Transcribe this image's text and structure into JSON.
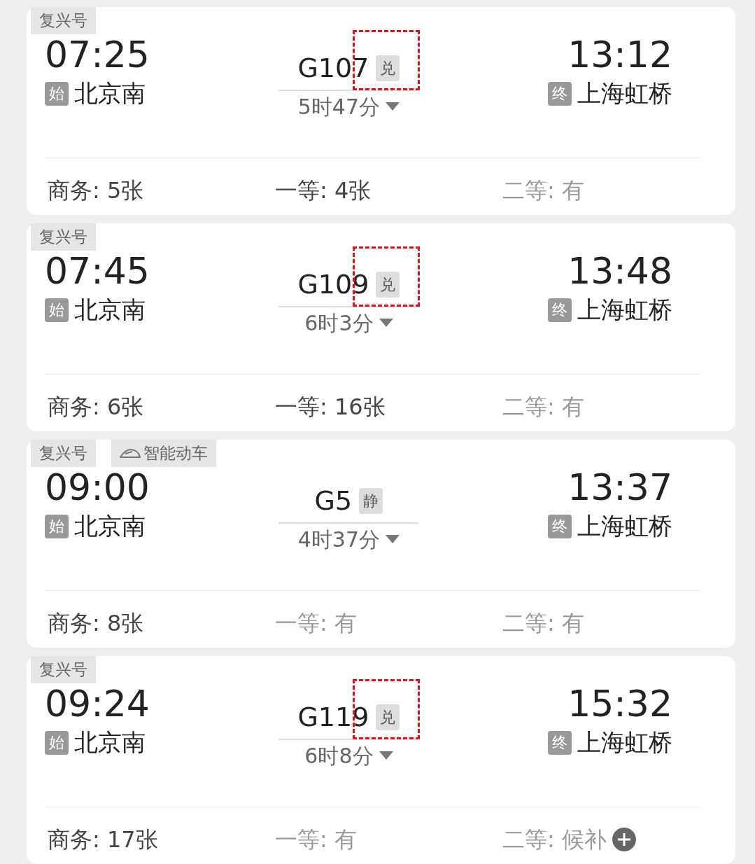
{
  "trains": [
    {
      "tags": [
        {
          "label": "复兴号",
          "kind": "plain"
        }
      ],
      "depart_time": "07:25",
      "depart_badge": "始",
      "depart_station": "北京南",
      "train_no": "G107",
      "train_badge": "兑",
      "highlighted": true,
      "duration": "5时47分",
      "arrive_time": "13:12",
      "arrive_badge": "终",
      "arrive_station": "上海虹桥",
      "seats": [
        {
          "label": "商务: ",
          "value": "5张",
          "available": true,
          "kind": "text"
        },
        {
          "label": "一等: ",
          "value": "4张",
          "available": true,
          "kind": "text"
        },
        {
          "label": "二等: ",
          "value": "有",
          "available": false,
          "kind": "text"
        }
      ]
    },
    {
      "tags": [
        {
          "label": "复兴号",
          "kind": "plain"
        }
      ],
      "depart_time": "07:45",
      "depart_badge": "始",
      "depart_station": "北京南",
      "train_no": "G109",
      "train_badge": "兑",
      "highlighted": true,
      "duration": "6时3分",
      "arrive_time": "13:48",
      "arrive_badge": "终",
      "arrive_station": "上海虹桥",
      "seats": [
        {
          "label": "商务: ",
          "value": "6张",
          "available": true,
          "kind": "text"
        },
        {
          "label": "一等: ",
          "value": "16张",
          "available": true,
          "kind": "text"
        },
        {
          "label": "二等: ",
          "value": "有",
          "available": false,
          "kind": "text"
        }
      ]
    },
    {
      "tags": [
        {
          "label": "复兴号",
          "kind": "plain"
        },
        {
          "label": "智能动车",
          "kind": "train"
        }
      ],
      "depart_time": "09:00",
      "depart_badge": "始",
      "depart_station": "北京南",
      "train_no": "G5",
      "train_badge": "静",
      "highlighted": false,
      "duration": "4时37分",
      "arrive_time": "13:37",
      "arrive_badge": "终",
      "arrive_station": "上海虹桥",
      "seats": [
        {
          "label": "商务: ",
          "value": "8张",
          "available": true,
          "kind": "text"
        },
        {
          "label": "一等: ",
          "value": "有",
          "available": false,
          "kind": "text"
        },
        {
          "label": "二等: ",
          "value": "有",
          "available": false,
          "kind": "text"
        }
      ]
    },
    {
      "tags": [
        {
          "label": "复兴号",
          "kind": "plain"
        }
      ],
      "depart_time": "09:24",
      "depart_badge": "始",
      "depart_station": "北京南",
      "train_no": "G119",
      "train_badge": "兑",
      "highlighted": true,
      "duration": "6时8分",
      "arrive_time": "15:32",
      "arrive_badge": "终",
      "arrive_station": "上海虹桥",
      "seats": [
        {
          "label": "商务: ",
          "value": "17张",
          "available": true,
          "kind": "text"
        },
        {
          "label": "一等: ",
          "value": "有",
          "available": false,
          "kind": "text"
        },
        {
          "label": "二等: ",
          "value": "候补",
          "available": false,
          "kind": "waitlist"
        }
      ]
    }
  ]
}
